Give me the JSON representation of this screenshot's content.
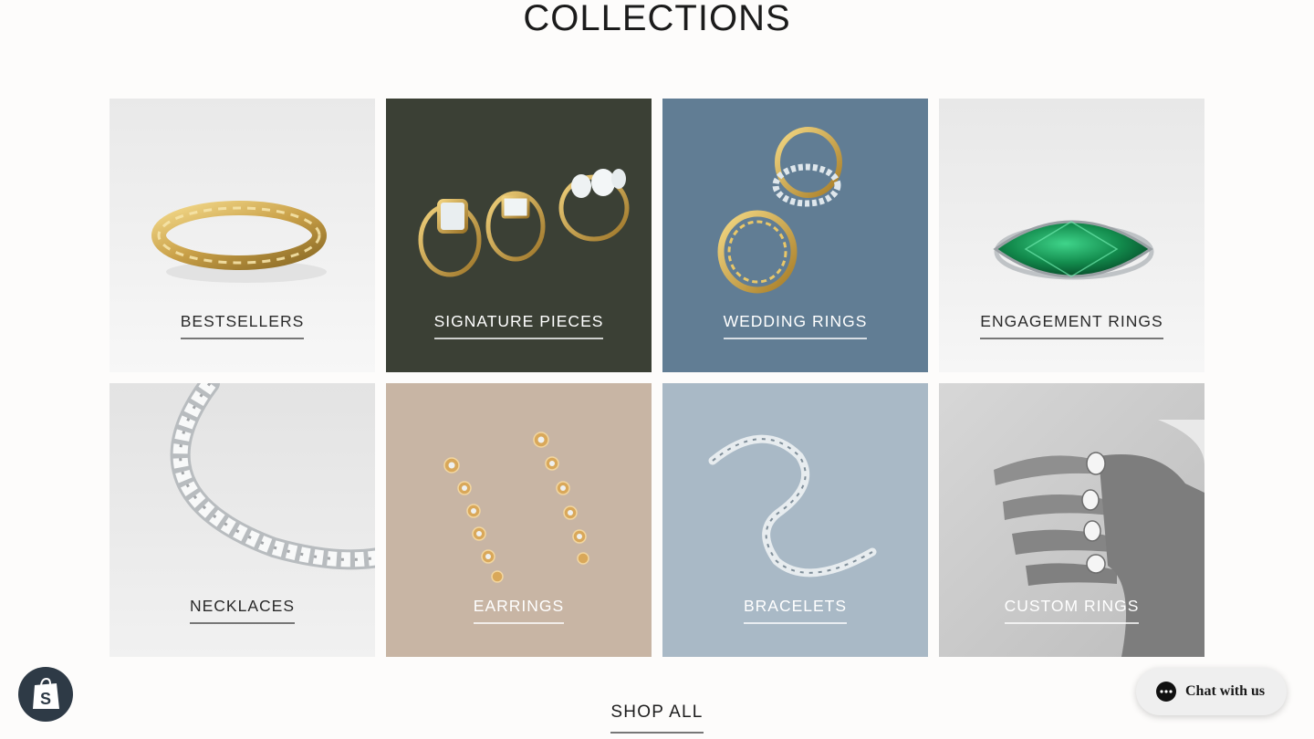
{
  "page": {
    "title": "COLLECTIONS"
  },
  "collections": [
    {
      "label": "BESTSELLERS",
      "bg": "#eeeeee"
    },
    {
      "label": "SIGNATURE PIECES",
      "bg": "#3b4035"
    },
    {
      "label": "WEDDING RINGS",
      "bg": "#617d94"
    },
    {
      "label": "ENGAGEMENT RINGS",
      "bg": "#ececec"
    },
    {
      "label": "NECKLACES",
      "bg": "#e6e6e6"
    },
    {
      "label": "EARRINGS",
      "bg": "#c8b5a4"
    },
    {
      "label": "BRACELETS",
      "bg": "#a9b9c6"
    },
    {
      "label": "CUSTOM RINGS",
      "bg": "#c9c9c9"
    }
  ],
  "shop_all": {
    "label": "SHOP ALL"
  },
  "chat": {
    "label": "Chat with us"
  },
  "icons": {
    "shop_badge": "shopify-bag-icon",
    "chat": "chat-bubble-icon"
  }
}
